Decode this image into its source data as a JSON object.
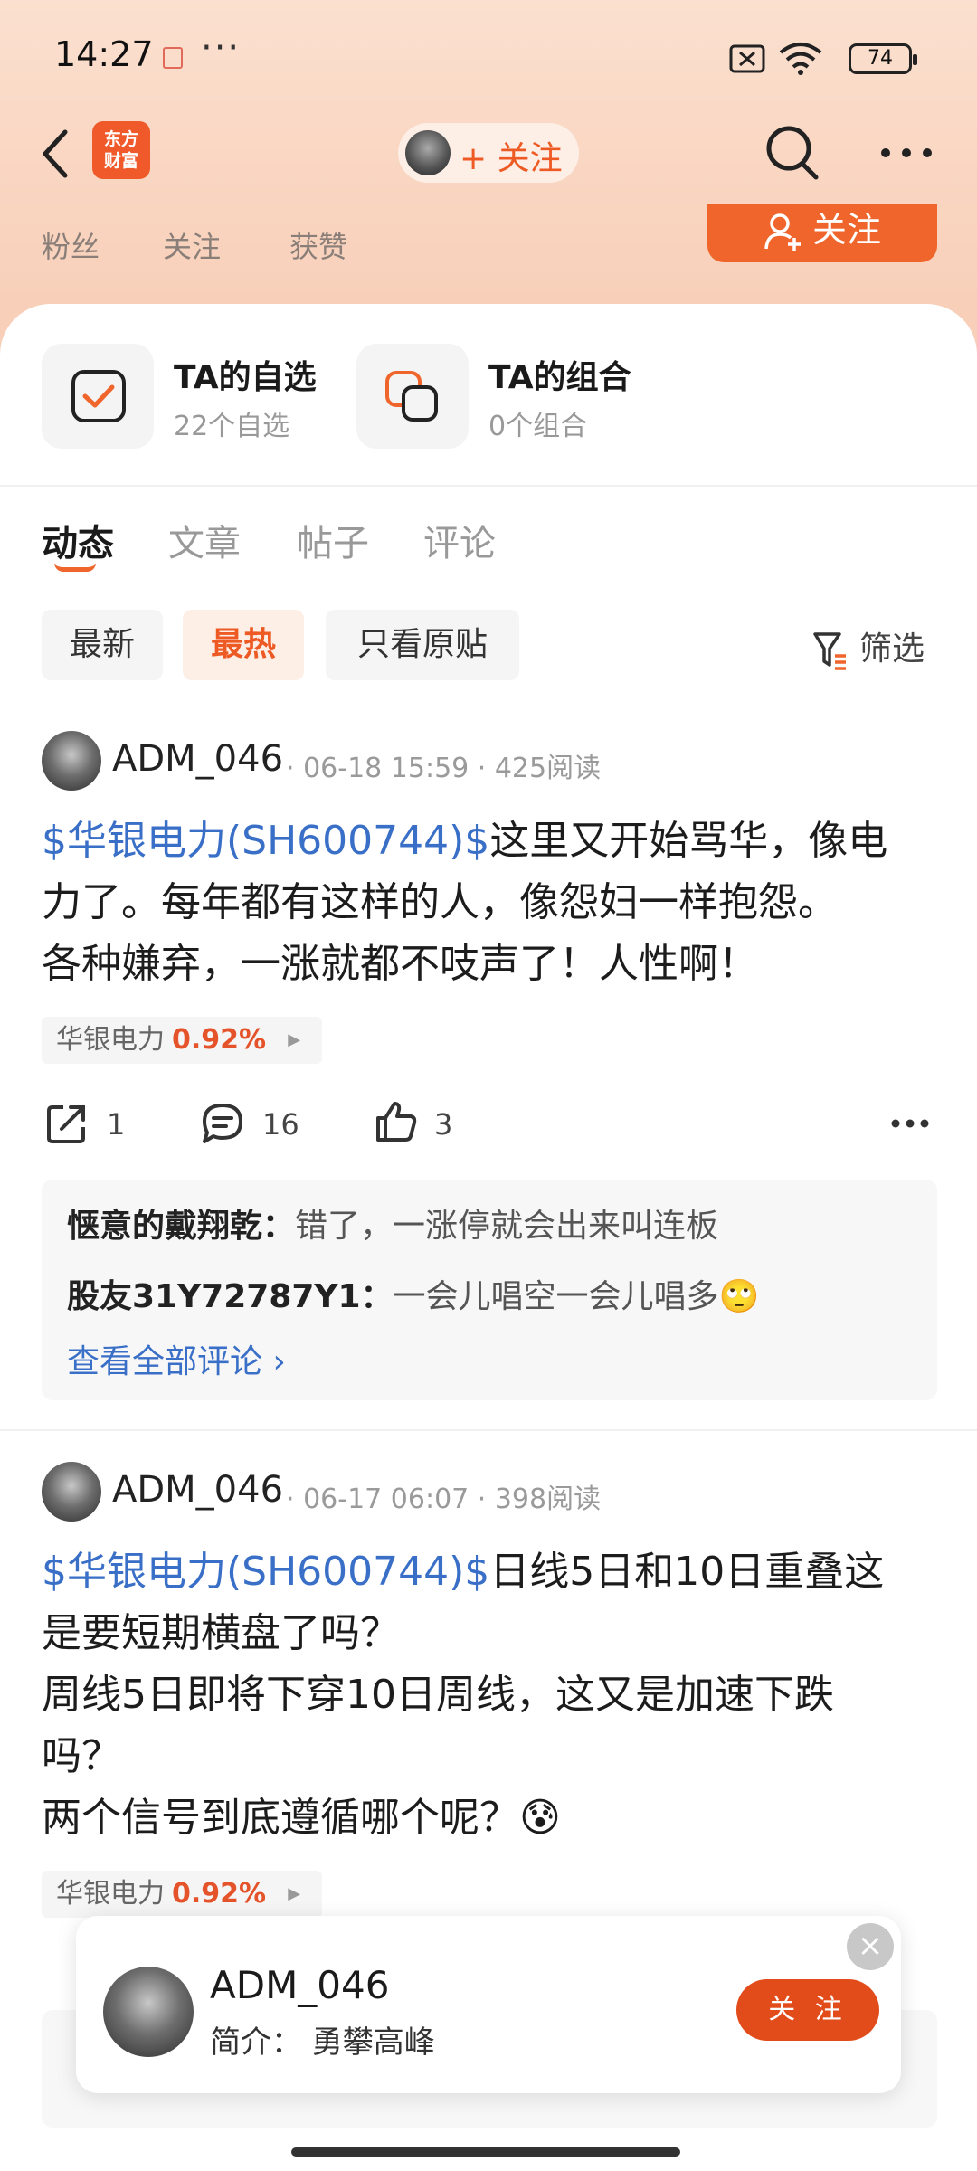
{
  "status_bar": {
    "time": "14:27",
    "dots": "···",
    "battery": "74",
    "icons": [
      "app-notification-icon",
      "sim-off-icon",
      "wifi-icon",
      "battery-icon"
    ]
  },
  "nav": {
    "logo_line1": "东方",
    "logo_line2": "财富",
    "follow_pill_label": "+ 关注",
    "icons": [
      "back-arrow-icon",
      "search-icon",
      "more-icon"
    ]
  },
  "profile_stats": {
    "fans_label": "粉丝",
    "following_label": "关注",
    "likes_label": "获赞",
    "follow_button": "关注"
  },
  "features": [
    {
      "title": "TA的自选",
      "subtitle": "22个自选"
    },
    {
      "title": "TA的组合",
      "subtitle": "0个组合"
    }
  ],
  "tabs": [
    "动态",
    "文章",
    "帖子",
    "评论"
  ],
  "active_tab": "动态",
  "filters": {
    "chips": [
      "最新",
      "最热",
      "只看原贴"
    ],
    "active": "最热",
    "filter_label": "筛选"
  },
  "posts": [
    {
      "author": "ADM_046",
      "meta": "· 06-18 15:59 · 425阅读",
      "stock_link": "$华银电力(SH600744)$",
      "text_lines": [
        "这里又开始骂华，像电",
        "力了。每年都有这样的人，像怨妇一样抱怨。",
        "各种嫌弃，一涨就都不吱声了！人性啊！"
      ],
      "tag_name": "华银电力",
      "tag_change": "0.92%",
      "shares": "1",
      "comments": "16",
      "likes": "3",
      "top_comments": [
        {
          "user": "惬意的戴翔乾：",
          "text": "错了，一涨停就会出来叫连板"
        },
        {
          "user": "股友31Y72787Y1：",
          "text": "一会儿唱空一会儿唱多🙄"
        }
      ],
      "view_all": "查看全部评论 ›"
    },
    {
      "author": "ADM_046",
      "meta": "· 06-17 06:07 · 398阅读",
      "stock_link": "$华银电力(SH600744)$",
      "text_lines": [
        "日线5日和10日重叠这",
        "是要短期横盘了吗？",
        "周线5日即将下穿10日周线，这又是加速下跌",
        "吗？",
        "两个信号到底遵循哪个呢？😰"
      ],
      "tag_name": "华银电力",
      "tag_change": "0.92%"
    }
  ],
  "float_card": {
    "name": "ADM_046",
    "bio": "简介：  勇攀高峰",
    "button": "关 注",
    "close": "×"
  },
  "colors": {
    "accent": "#F0652B",
    "link_blue": "#3A6FC8",
    "gain_red": "#E5532A"
  }
}
